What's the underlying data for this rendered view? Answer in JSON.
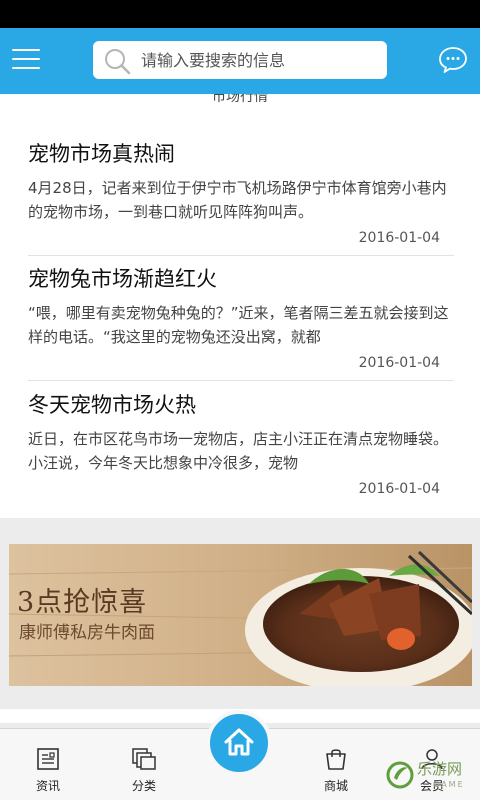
{
  "header": {
    "search_placeholder": "请输入要搜索的信息"
  },
  "news": {
    "section_title": "市场行情",
    "items": [
      {
        "title": "宠物市场真热闹",
        "desc": "4月28日，记者来到位于伊宁市飞机场路伊宁市体育馆旁小巷内的宠物市场，一到巷口就听见阵阵狗叫声。",
        "date": "2016-01-04"
      },
      {
        "title": "宠物兔市场渐趋红火",
        "desc": "“喂，哪里有卖宠物兔种兔的？”近来，笔者隔三差五就会接到这样的电话。“我这里的宠物兔还没出窝，就都",
        "date": "2016-01-04"
      },
      {
        "title": "冬天宠物市场火热",
        "desc": "近日，在市区花鸟市场一宠物店，店主小汪正在清点宠物睡袋。小汪说，今年冬天比想象中冷很多，宠物",
        "date": "2016-01-04"
      }
    ]
  },
  "banner": {
    "headline": "3点抢惊喜",
    "subline": "康师傅私房牛肉面"
  },
  "tabbar": {
    "news": "资讯",
    "category": "分类",
    "mall": "商城",
    "member": "会员"
  },
  "watermark": {
    "text": "乐游网",
    "sub": "GAME"
  },
  "colors": {
    "accent": "#2aa8e6",
    "title": "#111111",
    "body": "#444444"
  }
}
